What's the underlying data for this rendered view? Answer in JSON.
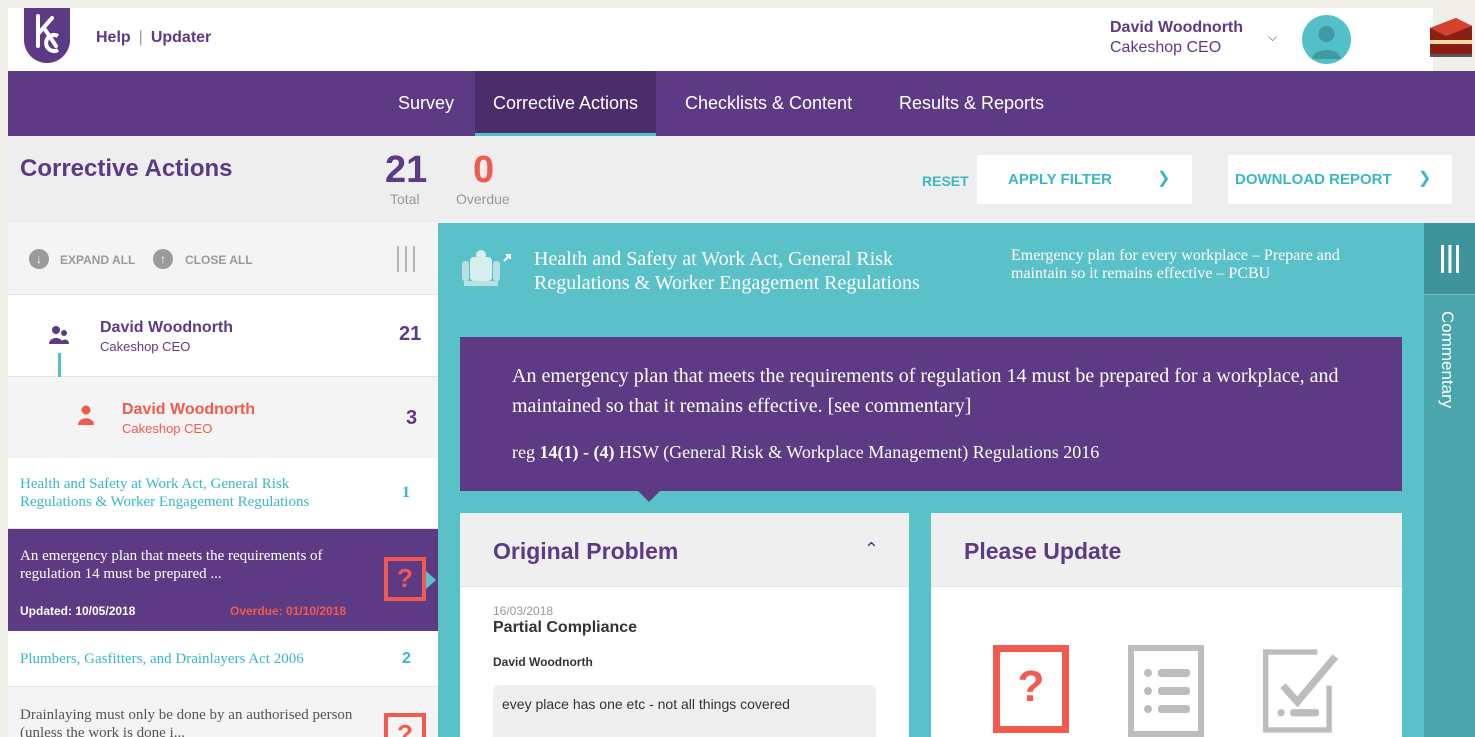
{
  "topbar": {
    "help_label": "Help",
    "separator": "|",
    "updater_label": "Updater",
    "user_name": "David Woodnorth",
    "user_role": "Cakeshop CEO"
  },
  "nav": {
    "items": [
      "Survey",
      "Corrective Actions",
      "Checklists & Content",
      "Results & Reports"
    ],
    "active": "Corrective Actions"
  },
  "header": {
    "title": "Corrective Actions",
    "total_value": "21",
    "total_label": "Total",
    "overdue_value": "0",
    "overdue_label": "Overdue",
    "reset_label": "RESET",
    "filter_label": "APPLY FILTER",
    "download_label": "DOWNLOAD REPORT"
  },
  "left_panel": {
    "expand_all": "EXPAND ALL",
    "close_all": "CLOSE ALL",
    "owner": {
      "name": "David Woodnorth",
      "role": "Cakeshop CEO",
      "count": "21"
    },
    "sub_owner": {
      "name": "David Woodnorth",
      "role": "Cakeshop CEO",
      "count": "3"
    },
    "acts": [
      {
        "title": "Health and Safety at Work Act, General Risk Regulations & Worker Engagement Regulations",
        "count": "1"
      },
      {
        "title": "Plumbers, Gasfitters, and Drainlayers Act 2006",
        "count": "2"
      }
    ],
    "selected": {
      "text": "An emergency plan that meets the requirements of regulation 14 must be prepared ...",
      "updated": "Updated: 10/05/2018",
      "overdue": "Overdue: 01/10/2018",
      "flag": "?"
    },
    "next_item": {
      "text": "Drainlaying must only be done by an authorised person (unless the work is done i...",
      "flag": "?"
    }
  },
  "main": {
    "act_title": "Health and Safety at Work Act, General Risk Regulations & Worker Engagement Regulations",
    "act_subtitle": "Emergency plan for every workplace – Prepare and maintain so it remains effective – PCBU",
    "requirement": "An emergency plan that meets the requirements of regulation 14 must be prepared for a workplace, and maintained so that it remains effective. [see commentary]",
    "reference_prefix": "reg ",
    "reference_bold": "14(1) - (4)",
    "reference_suffix": " HSW (General Risk & Workplace Management) Regulations 2016",
    "original_problem": {
      "heading": "Original Problem",
      "date": "16/03/2018",
      "status": "Partial Compliance",
      "author": "David Woodnorth",
      "note": "evey place has one etc - not all things covered"
    },
    "please_update": {
      "heading": "Please Update",
      "options": [
        "question-icon",
        "checklist-icon",
        "checked-list-icon"
      ],
      "question_mark": "?"
    }
  },
  "commentary": {
    "label": "Commentary"
  },
  "colors": {
    "brand_purple": "#5d3a84",
    "teal": "#5bc1c8",
    "accent_teal": "#3bb7c4",
    "alert_red": "#f05a4f"
  }
}
